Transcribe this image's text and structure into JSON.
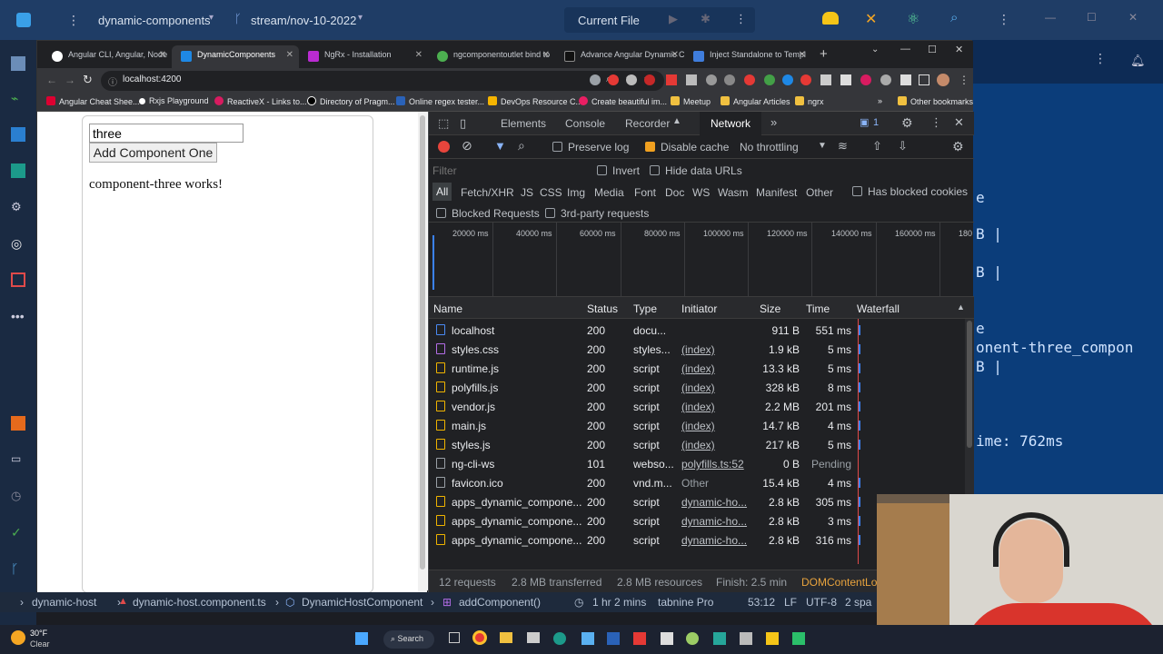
{
  "vscode": {
    "workspace": "dynamic-components",
    "branch": "stream/nov-10-2022",
    "run_target": "Current File",
    "terminal_lines": [
      "e",
      "B |",
      "B |",
      "e",
      "onent-three_compon",
      "B |",
      "ime: 762ms"
    ],
    "status": {
      "crumb1": "dynamic-host",
      "crumb2": "dynamic-host.component.ts",
      "crumb3": "DynamicHostComponent",
      "crumb4": "addComponent()",
      "time": "1 hr 2 mins",
      "tabnine": "tabnine Pro",
      "pos": "53:12",
      "eol": "LF",
      "enc": "UTF-8",
      "spaces": "2 spa"
    }
  },
  "chrome": {
    "tabs": [
      {
        "label": "Angular CLI, Angular, Node",
        "color": "#ffffff"
      },
      {
        "label": "DynamicComponents",
        "color": "#1e88e5"
      },
      {
        "label": "NgRx - Installation",
        "color": "#ba2bd2"
      },
      {
        "label": "ngcomponentoutlet bind to",
        "color": "#4caf50"
      },
      {
        "label": "Advance Angular Dynamic C",
        "color": "#222222"
      },
      {
        "label": "Inject Standalone to Templ",
        "color": "#3f7ddc"
      }
    ],
    "url": "localhost:4200",
    "bookmarks": [
      {
        "label": "Angular Cheat Shee...",
        "color": "#dd0031"
      },
      {
        "label": "Rxjs Playground",
        "color": "#ffffff"
      },
      {
        "label": "ReactiveX - Links to...",
        "color": "#d81b60"
      },
      {
        "label": "Directory of Pragm...",
        "color": "#000000"
      },
      {
        "label": "Online regex tester...",
        "color": "#2a62b8"
      },
      {
        "label": "DevOps Resource C...",
        "color": "#f5b400"
      },
      {
        "label": "Create beautiful im...",
        "color": "#e91e63"
      },
      {
        "label": "Meetup",
        "color": "#f0c040"
      },
      {
        "label": "Angular Articles",
        "color": "#f0c040"
      },
      {
        "label": "ngrx",
        "color": "#f0c040"
      },
      {
        "label": "Other bookmarks",
        "color": "#f0c040"
      }
    ]
  },
  "page": {
    "input_value": "three",
    "button_label": "Add Component One",
    "message": "component-three works!"
  },
  "devtools": {
    "tabs": [
      "Elements",
      "Console",
      "Recorder",
      "Network"
    ],
    "issues_count": "1",
    "toolbar": {
      "preserve_log": "Preserve log",
      "disable_cache": "Disable cache",
      "throttling": "No throttling"
    },
    "filter_placeholder": "Filter",
    "invert": "Invert",
    "hide_data_urls": "Hide data URLs",
    "types": [
      "All",
      "Fetch/XHR",
      "JS",
      "CSS",
      "Img",
      "Media",
      "Font",
      "Doc",
      "WS",
      "Wasm",
      "Manifest",
      "Other"
    ],
    "has_blocked_cookies": "Has blocked cookies",
    "blocked_requests": "Blocked Requests",
    "third_party": "3rd-party requests",
    "ticks": [
      "20000 ms",
      "40000 ms",
      "60000 ms",
      "80000 ms",
      "100000 ms",
      "120000 ms",
      "140000 ms",
      "160000 ms",
      "180"
    ],
    "columns": [
      "Name",
      "Status",
      "Type",
      "Initiator",
      "Size",
      "Time",
      "Waterfall"
    ],
    "rows": [
      {
        "name": "localhost",
        "status": "200",
        "type": "docu...",
        "initiator": "",
        "size": "911 B",
        "time": "551 ms",
        "icon": "#4a8af4"
      },
      {
        "name": "styles.css",
        "status": "200",
        "type": "styles...",
        "initiator": "(index)",
        "size": "1.9 kB",
        "time": "5 ms",
        "icon": "#b46de8"
      },
      {
        "name": "runtime.js",
        "status": "200",
        "type": "script",
        "initiator": "(index)",
        "size": "13.3 kB",
        "time": "5 ms",
        "icon": "#f0b400"
      },
      {
        "name": "polyfills.js",
        "status": "200",
        "type": "script",
        "initiator": "(index)",
        "size": "328 kB",
        "time": "8 ms",
        "icon": "#f0b400"
      },
      {
        "name": "vendor.js",
        "status": "200",
        "type": "script",
        "initiator": "(index)",
        "size": "2.2 MB",
        "time": "201 ms",
        "icon": "#f0b400"
      },
      {
        "name": "main.js",
        "status": "200",
        "type": "script",
        "initiator": "(index)",
        "size": "14.7 kB",
        "time": "4 ms",
        "icon": "#f0b400"
      },
      {
        "name": "styles.js",
        "status": "200",
        "type": "script",
        "initiator": "(index)",
        "size": "217 kB",
        "time": "5 ms",
        "icon": "#f0b400"
      },
      {
        "name": "ng-cli-ws",
        "status": "101",
        "type": "webso...",
        "initiator": "polyfills.ts:52",
        "size": "0 B",
        "time": "Pending",
        "icon": "#9aa0a6"
      },
      {
        "name": "favicon.ico",
        "status": "200",
        "type": "vnd.m...",
        "initiator": "Other",
        "size": "15.4 kB",
        "time": "4 ms",
        "icon": "#9aa0a6"
      },
      {
        "name": "apps_dynamic_compone...",
        "status": "200",
        "type": "script",
        "initiator": "dynamic-ho...",
        "size": "2.8 kB",
        "time": "305 ms",
        "icon": "#f0b400"
      },
      {
        "name": "apps_dynamic_compone...",
        "status": "200",
        "type": "script",
        "initiator": "dynamic-ho...",
        "size": "2.8 kB",
        "time": "3 ms",
        "icon": "#f0b400"
      },
      {
        "name": "apps_dynamic_compone...",
        "status": "200",
        "type": "script",
        "initiator": "dynamic-ho...",
        "size": "2.8 kB",
        "time": "316 ms",
        "icon": "#f0b400"
      }
    ],
    "summary": {
      "requests": "12 requests",
      "transferred": "2.8 MB transferred",
      "resources": "2.8 MB resources",
      "finish": "Finish: 2.5 min",
      "dcl": "DOMContentLo"
    }
  },
  "taskbar": {
    "temp": "30°F",
    "weather": "Clear",
    "search": "Search"
  }
}
